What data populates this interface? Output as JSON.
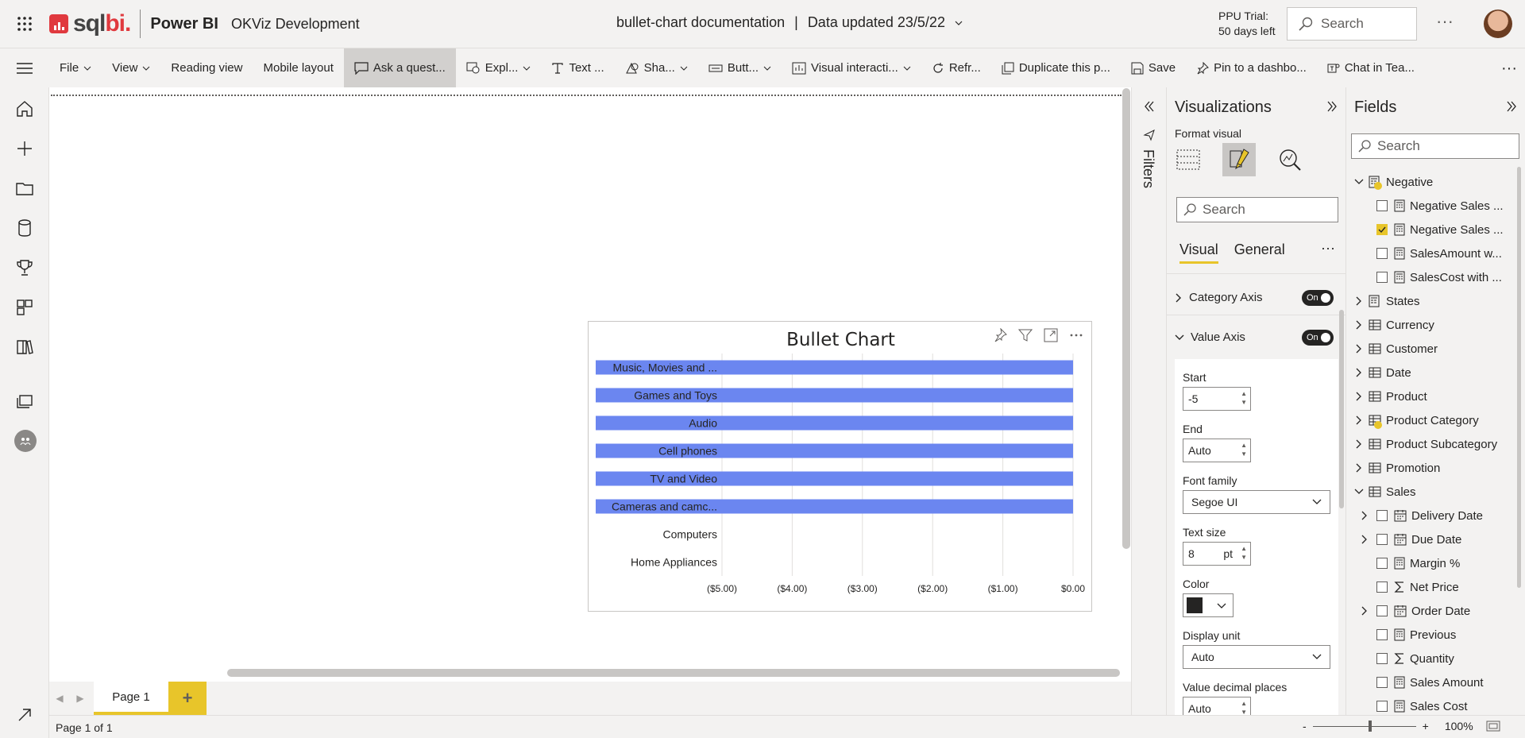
{
  "header": {
    "brand_left": "sql",
    "brand_right": "bi.",
    "app_name": "Power BI",
    "workspace": "OKViz Development",
    "report_name": "bullet-chart documentation",
    "separator": "|",
    "data_updated": "Data updated 23/5/22",
    "trial_line1": "PPU Trial:",
    "trial_line2": "50 days left",
    "search_placeholder": "Search",
    "more": "···"
  },
  "toolbar": {
    "items": [
      {
        "label": "File"
      },
      {
        "label": "View"
      },
      {
        "label": "Reading view"
      },
      {
        "label": "Mobile layout"
      },
      {
        "label": "Ask a quest..."
      },
      {
        "label": "Expl..."
      },
      {
        "label": "Text ..."
      },
      {
        "label": "Sha..."
      },
      {
        "label": "Butt..."
      },
      {
        "label": "Visual interacti..."
      },
      {
        "label": "Refr..."
      },
      {
        "label": "Duplicate this p..."
      },
      {
        "label": "Save"
      },
      {
        "label": "Pin to a dashbo..."
      },
      {
        "label": "Chat in Tea..."
      }
    ],
    "more": "···"
  },
  "visual": {
    "title": "Bullet Chart"
  },
  "chart_data": {
    "type": "bar",
    "orientation": "horizontal",
    "title": "Bullet Chart",
    "categories": [
      "Music, Movies and ...",
      "Games and Toys",
      "Audio",
      "Cell phones",
      "TV and Video",
      "Cameras and camc...",
      "Computers",
      "Home Appliances"
    ],
    "series": [
      {
        "values": [
          -5,
          -5,
          -5,
          -5,
          -5,
          -5,
          0,
          0
        ],
        "color": "#6b86f0"
      }
    ],
    "xlim": [
      -5,
      0
    ],
    "x_ticks": [
      -5,
      -4,
      -3,
      -2,
      -1,
      0
    ],
    "x_tick_labels": [
      "($5.00)",
      "($4.00)",
      "($3.00)",
      "($2.00)",
      "($1.00)",
      "$0.00"
    ],
    "grid": true
  },
  "pages": {
    "tab_label": "Page 1",
    "add": "+",
    "status": "Page 1 of 1",
    "zoom_minus": "-",
    "zoom_plus": "+",
    "zoom": "100%"
  },
  "filters": {
    "label": "Filters"
  },
  "viz_pane": {
    "title": "Visualizations",
    "format_label": "Format visual",
    "search_placeholder": "Search",
    "tab_visual": "Visual",
    "tab_general": "General",
    "more": "···",
    "sections": [
      {
        "label": "Category Axis",
        "toggle": "On"
      },
      {
        "label": "Value Axis",
        "toggle": "On"
      }
    ],
    "fields": {
      "start_label": "Start",
      "start_value": "-5",
      "end_label": "End",
      "end_value": "Auto",
      "font_label": "Font family",
      "font_value": "Segoe UI",
      "text_size_label": "Text size",
      "text_size_value": "8",
      "text_size_unit": "pt",
      "color_label": "Color",
      "color_value": "#252423",
      "display_unit_label": "Display unit",
      "display_unit_value": "Auto",
      "decimals_label": "Value decimal places",
      "decimals_value": "Auto"
    }
  },
  "fields_pane": {
    "title": "Fields",
    "search_placeholder": "Search",
    "items": [
      {
        "label": "Negative",
        "level": 0,
        "expanded": true,
        "icon": "calc-table-icon",
        "checked": null
      },
      {
        "label": "Negative Sales ...",
        "level": 1,
        "icon": "measure-icon",
        "checked": false
      },
      {
        "label": "Negative Sales ...",
        "level": 1,
        "icon": "measure-icon",
        "checked": true
      },
      {
        "label": "SalesAmount w...",
        "level": 1,
        "icon": "measure-icon",
        "checked": false
      },
      {
        "label": "SalesCost with ...",
        "level": 1,
        "icon": "measure-icon",
        "checked": false
      },
      {
        "label": "States",
        "level": 0,
        "expanded": false,
        "icon": "calc-table-icon",
        "checked": null
      },
      {
        "label": "Currency",
        "level": 0,
        "expanded": false,
        "icon": "table-icon",
        "checked": null
      },
      {
        "label": "Customer",
        "level": 0,
        "expanded": false,
        "icon": "table-icon",
        "checked": null
      },
      {
        "label": "Date",
        "level": 0,
        "expanded": false,
        "icon": "table-icon",
        "checked": null
      },
      {
        "label": "Product",
        "level": 0,
        "expanded": false,
        "icon": "table-icon",
        "checked": null
      },
      {
        "label": "Product Category",
        "level": 0,
        "expanded": false,
        "icon": "table-icon",
        "checked": null,
        "badge": true
      },
      {
        "label": "Product Subcategory",
        "level": 0,
        "expanded": false,
        "icon": "table-icon",
        "checked": null
      },
      {
        "label": "Promotion",
        "level": 0,
        "expanded": false,
        "icon": "table-icon",
        "checked": null
      },
      {
        "label": "Sales",
        "level": 0,
        "expanded": true,
        "icon": "table-icon",
        "checked": null
      },
      {
        "label": "Delivery Date",
        "level": 1,
        "expandable": true,
        "icon": "calendar-icon",
        "checked": false
      },
      {
        "label": "Due Date",
        "level": 1,
        "expandable": true,
        "icon": "calendar-icon",
        "checked": false
      },
      {
        "label": "Margin %",
        "level": 1,
        "icon": "measure-icon",
        "checked": false
      },
      {
        "label": "Net Price",
        "level": 1,
        "icon": "sigma-icon",
        "checked": false
      },
      {
        "label": "Order Date",
        "level": 1,
        "expandable": true,
        "icon": "calendar-icon",
        "checked": false
      },
      {
        "label": "Previous",
        "level": 1,
        "icon": "measure-icon",
        "checked": false
      },
      {
        "label": "Quantity",
        "level": 1,
        "icon": "sigma-icon",
        "checked": false
      },
      {
        "label": "Sales Amount",
        "level": 1,
        "icon": "measure-icon",
        "checked": false
      },
      {
        "label": "Sales Cost",
        "level": 1,
        "icon": "measure-icon",
        "checked": false
      }
    ]
  },
  "colors": {
    "accent": "#e8c52a",
    "bar": "#6b86f0",
    "brand": "#e0393e"
  }
}
